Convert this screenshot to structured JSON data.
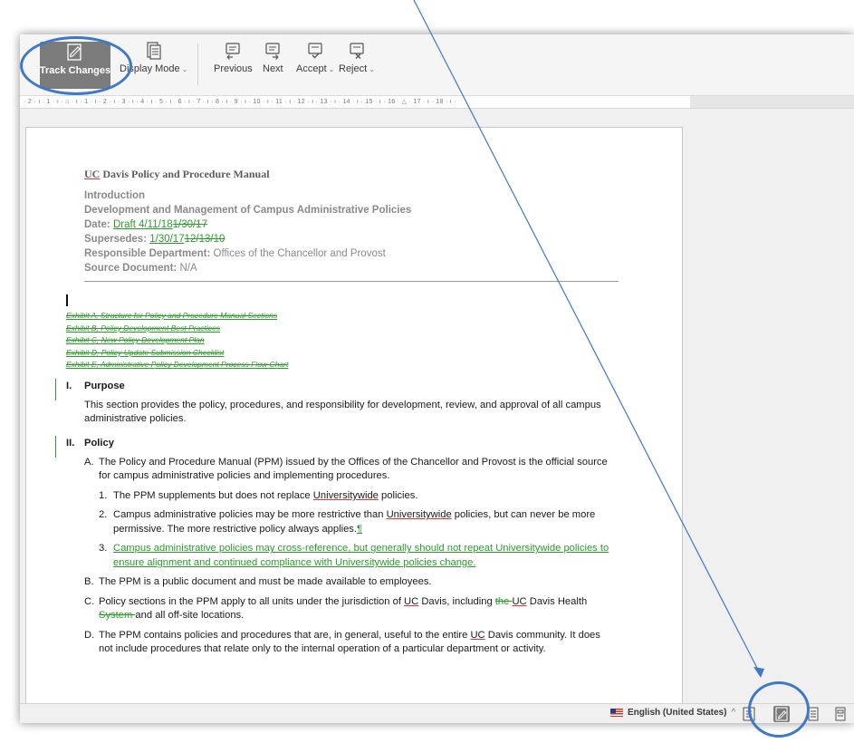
{
  "toolbar": {
    "track_changes": "Track Changes",
    "display_mode": "Display Mode",
    "previous": "Previous",
    "next": "Next",
    "accept": "Accept",
    "reject": "Reject"
  },
  "ruler_text": "· 2 · ı · 1 · ı · ⌂ · ı · 1 · ı · 2 · ı · 3 · ı · 4 · ı · 5 · ı · 6 · ı · 7 · ı · 8 · ı · 9 · ı · 10 · ı · 11 · ı · 12 · ı · 13 · ı · 14 · ı · 15 · ı · 16 · △ · 17 · ı · 18 · ı ·",
  "document": {
    "org_uc": "UC",
    "org_rest": " Davis Policy and Procedure Manual",
    "introduction": "Introduction",
    "doc_title": "Development and Management of Campus Administrative Policies",
    "date_label": "Date:",
    "date_ins": "Draft 4/11/18",
    "date_del": "1/30/17",
    "supersedes_label": "Supersedes:",
    "supersedes_ins": "1/30/17",
    "supersedes_del": "12/13/10",
    "dept_label": "Responsible Department:",
    "dept_value": "Offices of the Chancellor and Provost",
    "source_label": "Source Document:",
    "source_value": "N/A",
    "exhibits": [
      "Exhibit A, Structure for Policy and Procedure Manual Sections",
      "Exhibit B, Policy Development Best Practices",
      "Exhibit C, New Policy Development Plan",
      "Exhibit D, Policy Update Submission Checklist",
      "Exhibit E, Administrative Policy Development Process Flow Chart"
    ],
    "sec1_num": "I.",
    "sec1_title": "Purpose",
    "sec1_text": "This section provides the policy, procedures, and responsibility for development, review, and approval of all campus administrative policies.",
    "sec2_num": "II.",
    "sec2_title": "Policy",
    "A_num": "A.",
    "A_text": "The Policy and Procedure Manual (PPM) issued by the Offices of the Chancellor and Provost is the official source for campus administrative policies and implementing procedures.",
    "A1_num": "1.",
    "A1_pre": "The PPM supplements but does not replace ",
    "A1_u": "Universitywide",
    "A1_post": " policies.",
    "A2_num": "2.",
    "A2_pre": "Campus administrative policies may be more restrictive than ",
    "A2_u": "Universitywide",
    "A2_post": " policies, but can never be more permissive. The more restrictive policy always applies.",
    "A2_mark": "¶",
    "A3_num": "3.",
    "A3_text": "Campus administrative policies may cross-reference, but generally should not repeat Universitywide policies to ensure alignment and continued compliance with Universitywide policies change.",
    "B_num": "B.",
    "B_text": "The PPM is a public document and must be made available to employees.",
    "C_num": "C.",
    "C_pre": "Policy sections in the PPM apply to all units under the jurisdiction of ",
    "C_uc": "UC",
    "C_mid": " Davis, including ",
    "C_del1": "the ",
    "C_uc2": "UC",
    "C_mid2": " Davis Health ",
    "C_del2": "System ",
    "C_post": "and all off-site locations.",
    "D_num": "D.",
    "D_pre": "The PPM contains policies and procedures that are, in general, useful to the entire ",
    "D_uc": "UC",
    "D_post": " Davis community. It does not include procedures that relate only to the internal operation of a particular department or activity."
  },
  "statusbar": {
    "language": "English (United States)",
    "caret": "^"
  },
  "colors": {
    "accent_annotation": "#3f78c6",
    "track_insert": "#2e9a2e",
    "active_button": "#7b7b7b"
  },
  "icons": [
    "track-changes-icon",
    "display-mode-icon",
    "previous-change-icon",
    "next-change-icon",
    "accept-icon",
    "reject-icon",
    "us-flag-icon",
    "read-mode-icon",
    "track-changes-status-icon",
    "print-layout-icon",
    "web-layout-icon"
  ]
}
